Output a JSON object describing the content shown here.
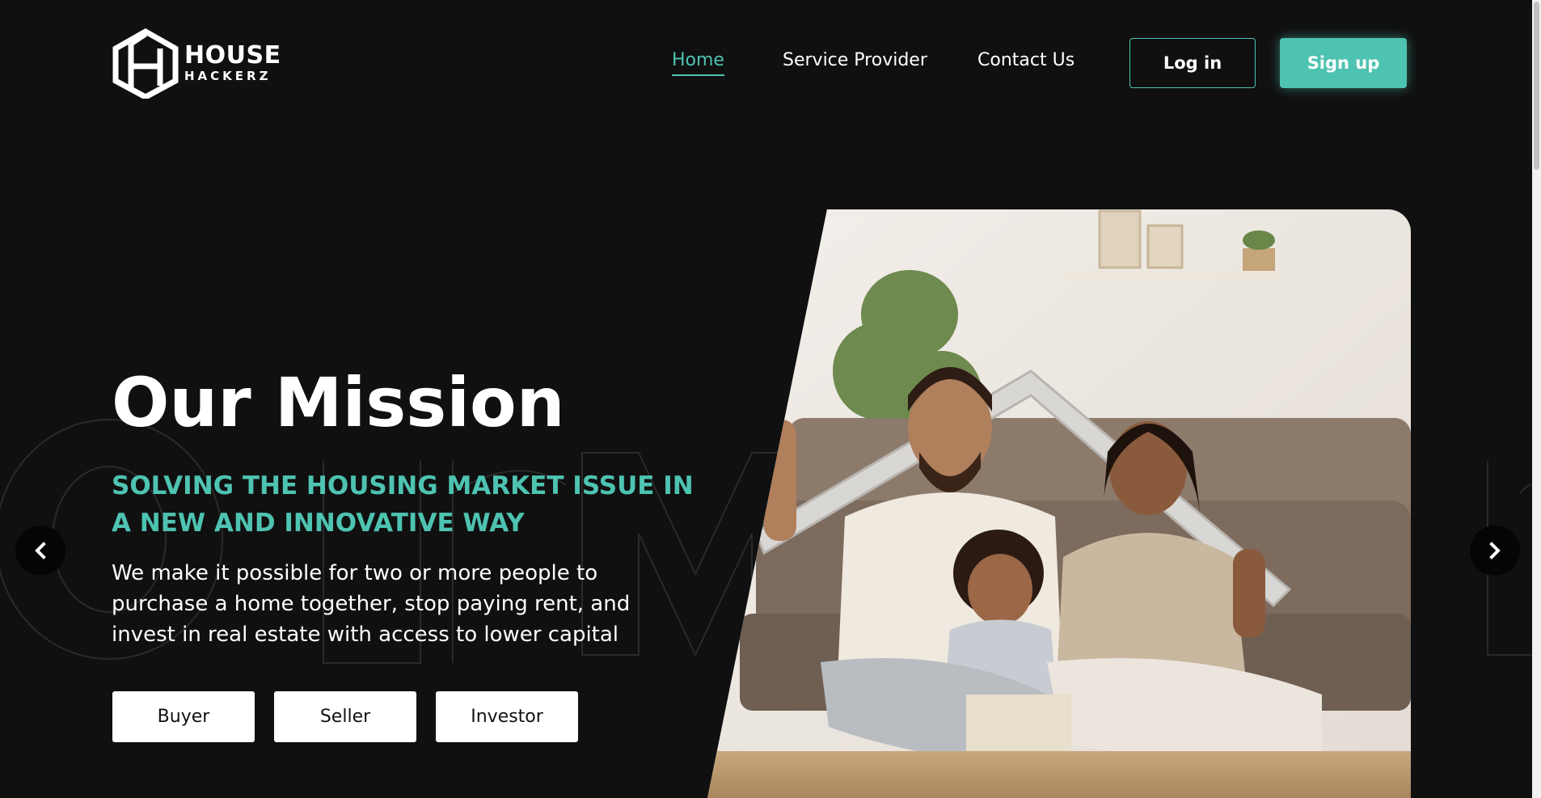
{
  "brand": {
    "line1": "HOUSE",
    "line2": "HACKERZ",
    "logo_icon": "house-h-logo-icon"
  },
  "nav": {
    "items": [
      {
        "label": "Home",
        "active": true
      },
      {
        "label": "Service Provider",
        "active": false
      },
      {
        "label": "Contact Us",
        "active": false
      }
    ]
  },
  "auth": {
    "login_label": "Log in",
    "signup_label": "Sign up"
  },
  "hero": {
    "title": "Our Mission",
    "subtitle": "SOLVING THE HOUSING MARKET ISSUE IN A NEW AND INNOVATIVE WAY",
    "description": "We make it possible for two or more people to purchase a home together, stop paying rent, and invest in real estate with access to lower capital",
    "roles": [
      "Buyer",
      "Seller",
      "Investor"
    ],
    "image_alt": "family-under-roof-photo"
  },
  "carousel": {
    "prev_icon": "chevron-left-icon",
    "next_icon": "chevron-right-icon"
  },
  "colors": {
    "accent": "#4ec3b1",
    "background": "#101010",
    "text": "#ffffff",
    "button_bg": "#ffffff",
    "button_text": "#111111"
  }
}
